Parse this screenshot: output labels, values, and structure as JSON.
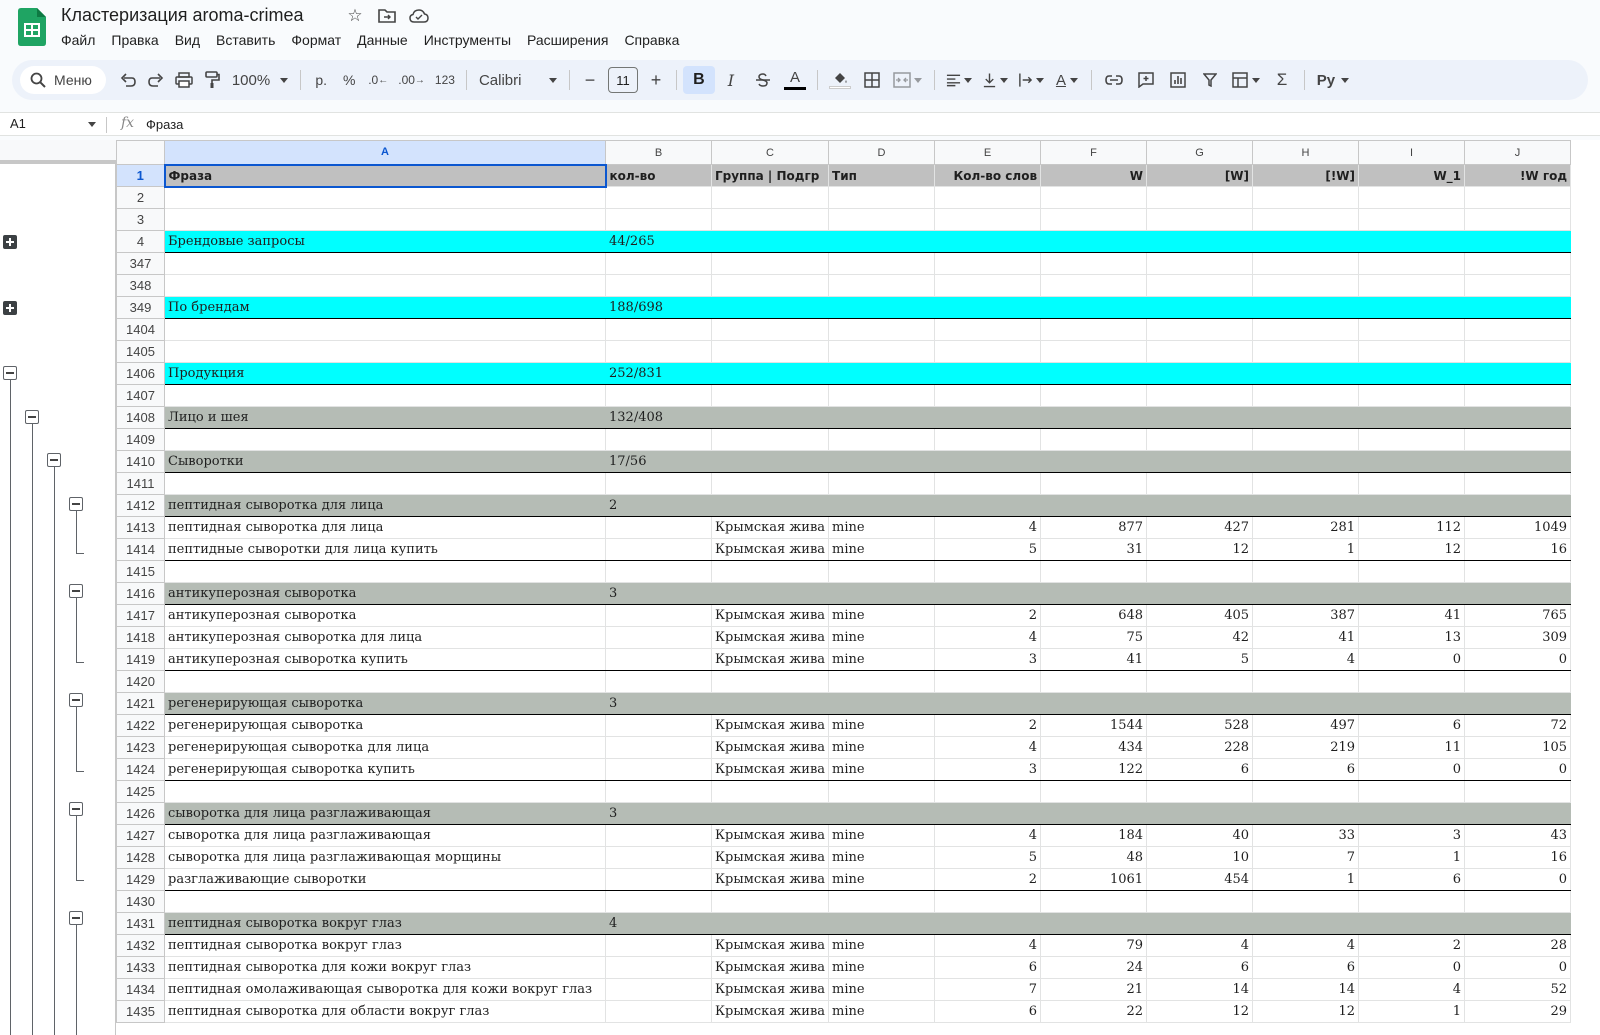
{
  "app": {
    "title": "Кластеризация aroma-crimea",
    "icons": [
      "sheets-logo-icon",
      "star-icon",
      "move-folder-icon",
      "cloud-status-icon"
    ]
  },
  "menu": [
    "Файл",
    "Правка",
    "Вид",
    "Вставить",
    "Формат",
    "Данные",
    "Инструменты",
    "Расширения",
    "Справка"
  ],
  "toolbar": {
    "search_label": "Меню",
    "zoom": "100%",
    "currency": "р.",
    "percent": "%",
    "dec_decrease": ".0",
    "dec_increase": ".00",
    "number_format": "123",
    "font": "Calibri",
    "font_size": "11",
    "bold": "B",
    "italic": "I",
    "text_color_letter": "A",
    "text_rotate_letter": "A",
    "sigma": "Σ",
    "input_tools": "Py"
  },
  "formula_bar": {
    "cell_ref": "A1",
    "fx": "fx",
    "value": "Фраза"
  },
  "columns": [
    "A",
    "B",
    "C",
    "D",
    "E",
    "F",
    "G",
    "H",
    "I",
    "J"
  ],
  "rows": [
    {
      "n": "1",
      "type": "hdr",
      "cells": [
        "Фраза",
        "кол-во",
        "Группа | Подгр",
        "Тип",
        "Кол-во слов",
        "W",
        "[W]",
        "[!W]",
        "W_1",
        "!W год"
      ]
    },
    {
      "n": "2",
      "type": "blank",
      "cells": [
        "",
        "",
        "",
        "",
        "",
        "",
        "",
        "",
        "",
        ""
      ]
    },
    {
      "n": "3",
      "type": "blank",
      "cells": [
        "",
        "",
        "",
        "",
        "",
        "",
        "",
        "",
        "",
        ""
      ]
    },
    {
      "n": "4",
      "type": "cyan",
      "cells": [
        "Брендовые запросы",
        "44/265",
        "",
        "",
        "",
        "",
        "",
        "",
        "",
        ""
      ]
    },
    {
      "n": "347",
      "type": "blank",
      "cells": [
        "",
        "",
        "",
        "",
        "",
        "",
        "",
        "",
        "",
        ""
      ]
    },
    {
      "n": "348",
      "type": "blank",
      "cells": [
        "",
        "",
        "",
        "",
        "",
        "",
        "",
        "",
        "",
        ""
      ]
    },
    {
      "n": "349",
      "type": "cyan",
      "cells": [
        "По брендам",
        "188/698",
        "",
        "",
        "",
        "",
        "",
        "",
        "",
        ""
      ]
    },
    {
      "n": "1404",
      "type": "blank",
      "cells": [
        "",
        "",
        "",
        "",
        "",
        "",
        "",
        "",
        "",
        ""
      ]
    },
    {
      "n": "1405",
      "type": "blank",
      "cells": [
        "",
        "",
        "",
        "",
        "",
        "",
        "",
        "",
        "",
        ""
      ]
    },
    {
      "n": "1406",
      "type": "cyan",
      "cells": [
        "Продукция",
        "252/831",
        "",
        "",
        "",
        "",
        "",
        "",
        "",
        ""
      ]
    },
    {
      "n": "1407",
      "type": "blank",
      "cells": [
        "",
        "",
        "",
        "",
        "",
        "",
        "",
        "",
        "",
        ""
      ]
    },
    {
      "n": "1408",
      "type": "gray",
      "cells": [
        "Лицо и шея",
        "132/408",
        "",
        "",
        "",
        "",
        "",
        "",
        "",
        ""
      ]
    },
    {
      "n": "1409",
      "type": "blank",
      "cells": [
        "",
        "",
        "",
        "",
        "",
        "",
        "",
        "",
        "",
        ""
      ]
    },
    {
      "n": "1410",
      "type": "gray",
      "cells": [
        "Сыворотки",
        "17/56",
        "",
        "",
        "",
        "",
        "",
        "",
        "",
        ""
      ]
    },
    {
      "n": "1411",
      "type": "blank",
      "cells": [
        "",
        "",
        "",
        "",
        "",
        "",
        "",
        "",
        "",
        ""
      ]
    },
    {
      "n": "1412",
      "type": "gray",
      "cells": [
        "пептидная сыворотка для лица",
        "2",
        "",
        "",
        "",
        "",
        "",
        "",
        "",
        ""
      ]
    },
    {
      "n": "1413",
      "type": "data",
      "cells": [
        "пептидная сыворотка для лица",
        "",
        "Крымская жива",
        "mine",
        "4",
        "877",
        "427",
        "281",
        "112",
        "1049"
      ]
    },
    {
      "n": "1414",
      "type": "data",
      "last": true,
      "cells": [
        "пептидные сыворотки для лица купить",
        "",
        "Крымская жива",
        "mine",
        "5",
        "31",
        "12",
        "1",
        "12",
        "16"
      ]
    },
    {
      "n": "1415",
      "type": "blank",
      "cells": [
        "",
        "",
        "",
        "",
        "",
        "",
        "",
        "",
        "",
        ""
      ]
    },
    {
      "n": "1416",
      "type": "gray",
      "cells": [
        "антикуперозная сыворотка",
        "3",
        "",
        "",
        "",
        "",
        "",
        "",
        "",
        ""
      ]
    },
    {
      "n": "1417",
      "type": "data",
      "cells": [
        "антикуперозная сыворотка",
        "",
        "Крымская жива",
        "mine",
        "2",
        "648",
        "405",
        "387",
        "41",
        "765"
      ]
    },
    {
      "n": "1418",
      "type": "data",
      "cells": [
        "антикуперозная сыворотка для лица",
        "",
        "Крымская жива",
        "mine",
        "4",
        "75",
        "42",
        "41",
        "13",
        "309"
      ]
    },
    {
      "n": "1419",
      "type": "data",
      "last": true,
      "cells": [
        "антикуперозная сыворотка купить",
        "",
        "Крымская жива",
        "mine",
        "3",
        "41",
        "5",
        "4",
        "0",
        "0"
      ]
    },
    {
      "n": "1420",
      "type": "blank",
      "cells": [
        "",
        "",
        "",
        "",
        "",
        "",
        "",
        "",
        "",
        ""
      ]
    },
    {
      "n": "1421",
      "type": "gray",
      "cells": [
        "регенерирующая сыворотка",
        "3",
        "",
        "",
        "",
        "",
        "",
        "",
        "",
        ""
      ]
    },
    {
      "n": "1422",
      "type": "data",
      "cells": [
        "регенерирующая сыворотка",
        "",
        "Крымская жива",
        "mine",
        "2",
        "1544",
        "528",
        "497",
        "6",
        "72"
      ]
    },
    {
      "n": "1423",
      "type": "data",
      "cells": [
        "регенерирующая сыворотка для лица",
        "",
        "Крымская жива",
        "mine",
        "4",
        "434",
        "228",
        "219",
        "11",
        "105"
      ]
    },
    {
      "n": "1424",
      "type": "data",
      "last": true,
      "cells": [
        "регенерирующая сыворотка купить",
        "",
        "Крымская жива",
        "mine",
        "3",
        "122",
        "6",
        "6",
        "0",
        "0"
      ]
    },
    {
      "n": "1425",
      "type": "blank",
      "cells": [
        "",
        "",
        "",
        "",
        "",
        "",
        "",
        "",
        "",
        ""
      ]
    },
    {
      "n": "1426",
      "type": "gray",
      "cells": [
        "сыворотка для лица разглаживающая",
        "3",
        "",
        "",
        "",
        "",
        "",
        "",
        "",
        ""
      ]
    },
    {
      "n": "1427",
      "type": "data",
      "cells": [
        "сыворотка для лица разглаживающая",
        "",
        "Крымская жива",
        "mine",
        "4",
        "184",
        "40",
        "33",
        "3",
        "43"
      ]
    },
    {
      "n": "1428",
      "type": "data",
      "cells": [
        "сыворотка для лица разглаживающая морщины",
        "",
        "Крымская жива",
        "mine",
        "5",
        "48",
        "10",
        "7",
        "1",
        "16"
      ]
    },
    {
      "n": "1429",
      "type": "data",
      "last": true,
      "cells": [
        "разглаживающие сыворотки",
        "",
        "Крымская жива",
        "mine",
        "2",
        "1061",
        "454",
        "1",
        "6",
        "0"
      ]
    },
    {
      "n": "1430",
      "type": "blank",
      "cells": [
        "",
        "",
        "",
        "",
        "",
        "",
        "",
        "",
        "",
        ""
      ]
    },
    {
      "n": "1431",
      "type": "gray",
      "cells": [
        "пептидная сыворотка вокруг глаз",
        "4",
        "",
        "",
        "",
        "",
        "",
        "",
        "",
        ""
      ]
    },
    {
      "n": "1432",
      "type": "data",
      "cells": [
        "пептидная сыворотка вокруг глаз",
        "",
        "Крымская жива",
        "mine",
        "4",
        "79",
        "4",
        "4",
        "2",
        "28"
      ]
    },
    {
      "n": "1433",
      "type": "data",
      "cells": [
        "пептидная сыворотка для кожи вокруг глаз",
        "",
        "Крымская жива",
        "mine",
        "6",
        "24",
        "6",
        "6",
        "0",
        "0"
      ]
    },
    {
      "n": "1434",
      "type": "data",
      "cells": [
        "пептидная омолаживающая сыворотка для кожи вокруг глаз",
        "",
        "Крымская жива",
        "mine",
        "7",
        "21",
        "14",
        "14",
        "4",
        "52"
      ]
    },
    {
      "n": "1435",
      "type": "data",
      "cells": [
        "пептидная сыворотка для области вокруг глаз",
        "",
        "Крымская жива",
        "mine",
        "6",
        "22",
        "12",
        "12",
        "1",
        "29"
      ]
    }
  ],
  "colors": {
    "header_fill": "#c0c0c0",
    "category_fill": "#00ffff",
    "group_fill": "#b5bcb5",
    "selection": "#d3e3fd",
    "accent": "#0b57d0"
  }
}
